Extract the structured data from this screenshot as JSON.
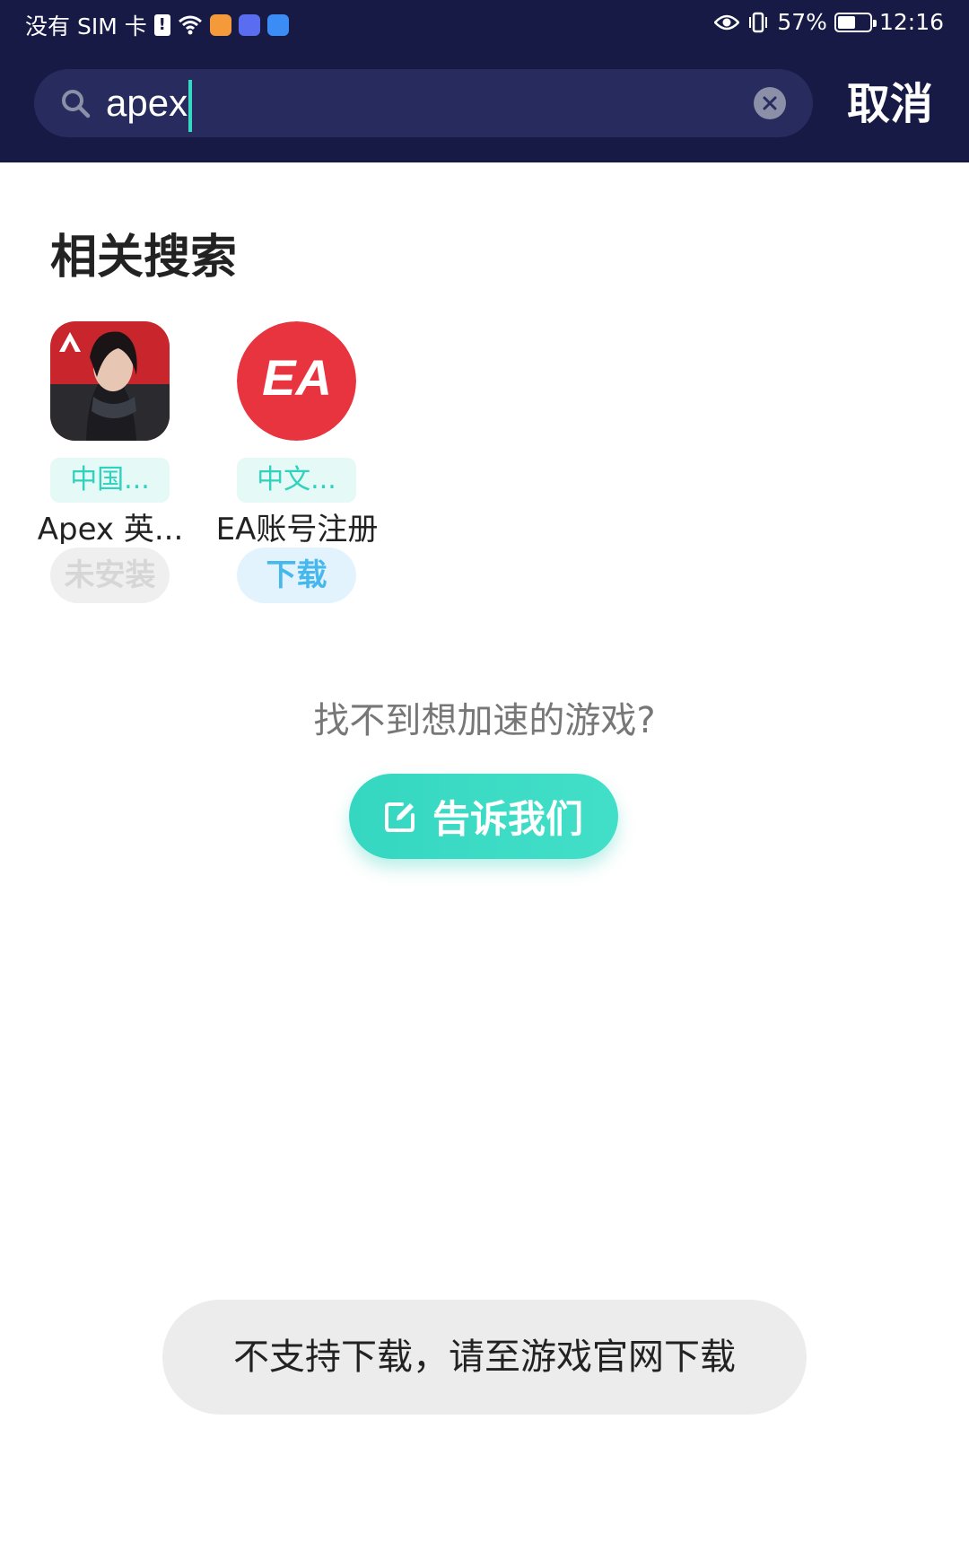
{
  "status_bar": {
    "carrier": "没有 SIM 卡",
    "battery_text": "57%",
    "battery_level": 0.57,
    "time": "12:16"
  },
  "search": {
    "query": "apex",
    "cancel_label": "取消"
  },
  "related": {
    "title": "相关搜索",
    "apps": [
      {
        "tag": "中国...",
        "name": "Apex 英...",
        "action": "未安装",
        "action_state": "disabled",
        "icon": "apex-legends-icon"
      },
      {
        "tag": "中文...",
        "name": "EA账号注册",
        "action": "下载",
        "action_state": "download",
        "icon": "ea-logo-icon",
        "icon_text": "EA"
      }
    ]
  },
  "prompt": "找不到想加速的游戏?",
  "tell_us_label": "告诉我们",
  "toast": "不支持下载，请至游戏官网下载",
  "colors": {
    "header_bg": "#161a45",
    "accent": "#35d8c2",
    "download_text": "#46b8ee",
    "ea_red": "#e8343f"
  }
}
